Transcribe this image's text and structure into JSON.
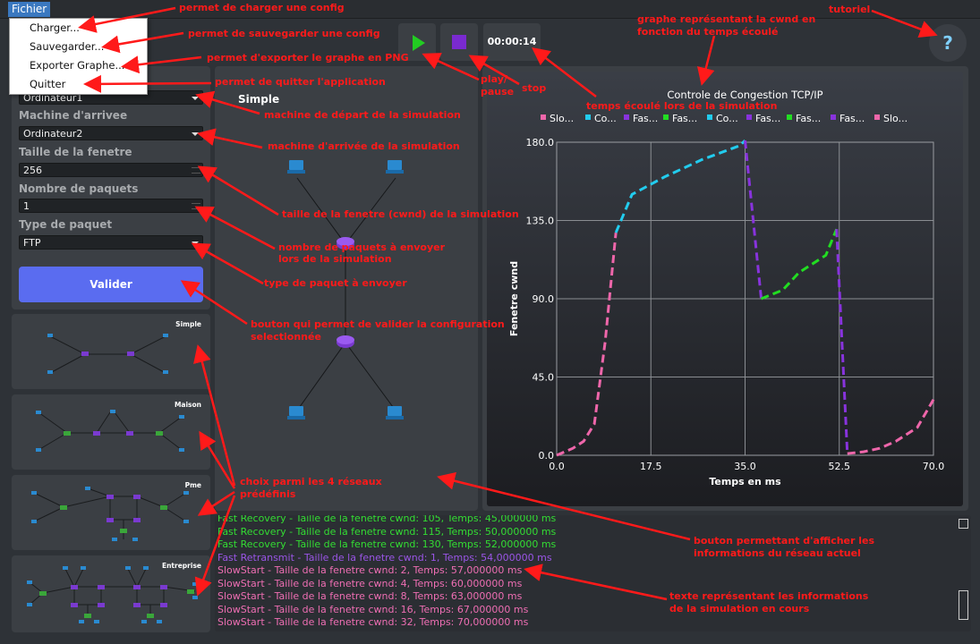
{
  "menubar": {
    "fichier": "Fichier"
  },
  "file_menu": {
    "items": [
      "Charger...",
      "Sauvegarder...",
      "Exporter Graphe...",
      "Quitter"
    ]
  },
  "config": {
    "depart_value": "Ordinateur1",
    "arrivee_label": "Machine d'arrivee",
    "arrivee_value": "Ordinateur2",
    "fenetre_label": "Taille de la fenetre",
    "fenetre_value": "256",
    "paquets_label": "Nombre de paquets",
    "paquets_value": "1",
    "type_label": "Type de paquet",
    "type_value": "FTP",
    "valider": "Valider"
  },
  "networks": [
    "Simple",
    "Maison",
    "Pme",
    "Entreprise"
  ],
  "topology": {
    "title": "Simple"
  },
  "toolbar": {
    "timer": "00:00:14",
    "help": "?",
    "play_icon": "play-icon",
    "stop_icon": "stop-icon"
  },
  "chart_data": {
    "type": "line",
    "title": "Controle de Congestion TCP/IP",
    "xlabel": "Temps en ms",
    "ylabel": "Fenetre cwnd",
    "xlim": [
      0,
      70
    ],
    "ylim": [
      0,
      180
    ],
    "xticks": [
      "0.0",
      "17.5",
      "35.0",
      "52.5",
      "70.0"
    ],
    "yticks": [
      "0.0",
      "45.0",
      "90.0",
      "135.0",
      "180.0"
    ],
    "grid": true,
    "legend_position": "top",
    "series": [
      {
        "name": "Slo...",
        "color": "#ee66aa",
        "x": [
          0,
          3,
          5,
          7,
          9,
          11
        ],
        "y": [
          0,
          4,
          8,
          18,
          65,
          128
        ]
      },
      {
        "name": "Co...",
        "color": "#22ccee",
        "x": [
          11,
          14,
          20,
          27,
          34,
          35
        ],
        "y": [
          128,
          150,
          160,
          170,
          178,
          181
        ]
      },
      {
        "name": "Fas...",
        "color": "#8833dd",
        "x": [
          35,
          38
        ],
        "y": [
          181,
          90
        ]
      },
      {
        "name": "Fas...",
        "color": "#22dd22",
        "x": [
          38,
          42,
          45,
          50,
          52
        ],
        "y": [
          90,
          95,
          105,
          115,
          130
        ]
      },
      {
        "name": "Co...",
        "color": "#22ccee",
        "x": [],
        "y": []
      },
      {
        "name": "Fas...",
        "color": "#8833dd",
        "x": [
          52,
          54
        ],
        "y": [
          130,
          1
        ]
      },
      {
        "name": "Fas...",
        "color": "#22dd22",
        "x": [],
        "y": []
      },
      {
        "name": "Fas...",
        "color": "#8833dd",
        "x": [],
        "y": []
      },
      {
        "name": "Slo...",
        "color": "#ee66aa",
        "x": [
          54,
          57,
          60,
          63,
          67,
          70
        ],
        "y": [
          1,
          2,
          4,
          8,
          16,
          32
        ]
      }
    ]
  },
  "log": [
    {
      "text": "Fast Recovery - Taille de la fenetre cwnd: 105, Temps: 45,000000 ms",
      "color": "#33dd33"
    },
    {
      "text": "Fast Recovery - Taille de la fenetre cwnd: 115, Temps: 50,000000 ms",
      "color": "#33dd33"
    },
    {
      "text": "Fast Recovery - Taille de la fenetre cwnd: 130, Temps: 52,000000 ms",
      "color": "#33dd33"
    },
    {
      "text": "Fast Retransmit - Taille de la fenetre cwnd: 1, Temps: 54,000000 ms",
      "color": "#9a55e6"
    },
    {
      "text": "SlowStart - Taille de la fenetre cwnd: 2, Temps: 57,000000 ms",
      "color": "#ee6eb3"
    },
    {
      "text": "SlowStart - Taille de la fenetre cwnd: 4, Temps: 60,000000 ms",
      "color": "#ee6eb3"
    },
    {
      "text": "SlowStart - Taille de la fenetre cwnd: 8, Temps: 63,000000 ms",
      "color": "#ee6eb3"
    },
    {
      "text": "SlowStart - Taille de la fenetre cwnd: 16, Temps: 67,000000 ms",
      "color": "#ee6eb3"
    },
    {
      "text": "SlowStart - Taille de la fenetre cwnd: 32, Temps: 70,000000 ms",
      "color": "#ee6eb3"
    }
  ],
  "annotations": {
    "a1": "permet de charger une config",
    "a2": "permet de sauvegarder une config",
    "a3": "permet d'exporter le graphe en PNG",
    "a4": "permet de quitter l'application",
    "a5": "machine de départ de la simulation",
    "a6": "machine d'arrivée de la simulation",
    "a7": "taille de la fenetre (cwnd) de la simulation",
    "a8a": "nombre de paquets à envoyer",
    "a8b": "lors de la simulation",
    "a9": "type de paquet à envoyer",
    "a10a": "bouton qui permet de valider la configuration",
    "a10b": "selectionnée",
    "a11a": "choix parmi les 4 réseaux",
    "a11b": "prédéfinis",
    "a12a": "bouton permettant d'afficher les",
    "a12b": "informations du réseau actuel",
    "a13a": "texte représentant les informations",
    "a13b": "de la simulation en cours",
    "a14a": "play/",
    "a14b": "pause",
    "a15": "stop",
    "a16": "temps écoulé lors de la simulation",
    "a17a": "graphe représentant la cwnd en",
    "a17b": "fonction du temps écoulé",
    "a18": "tutoriel"
  },
  "colors": {
    "annotation": "#ff1a1a",
    "valider": "#5a6cf0",
    "router": "#7a3ad0",
    "switch": "#3aa63a",
    "pc": "#2a8ad0"
  }
}
